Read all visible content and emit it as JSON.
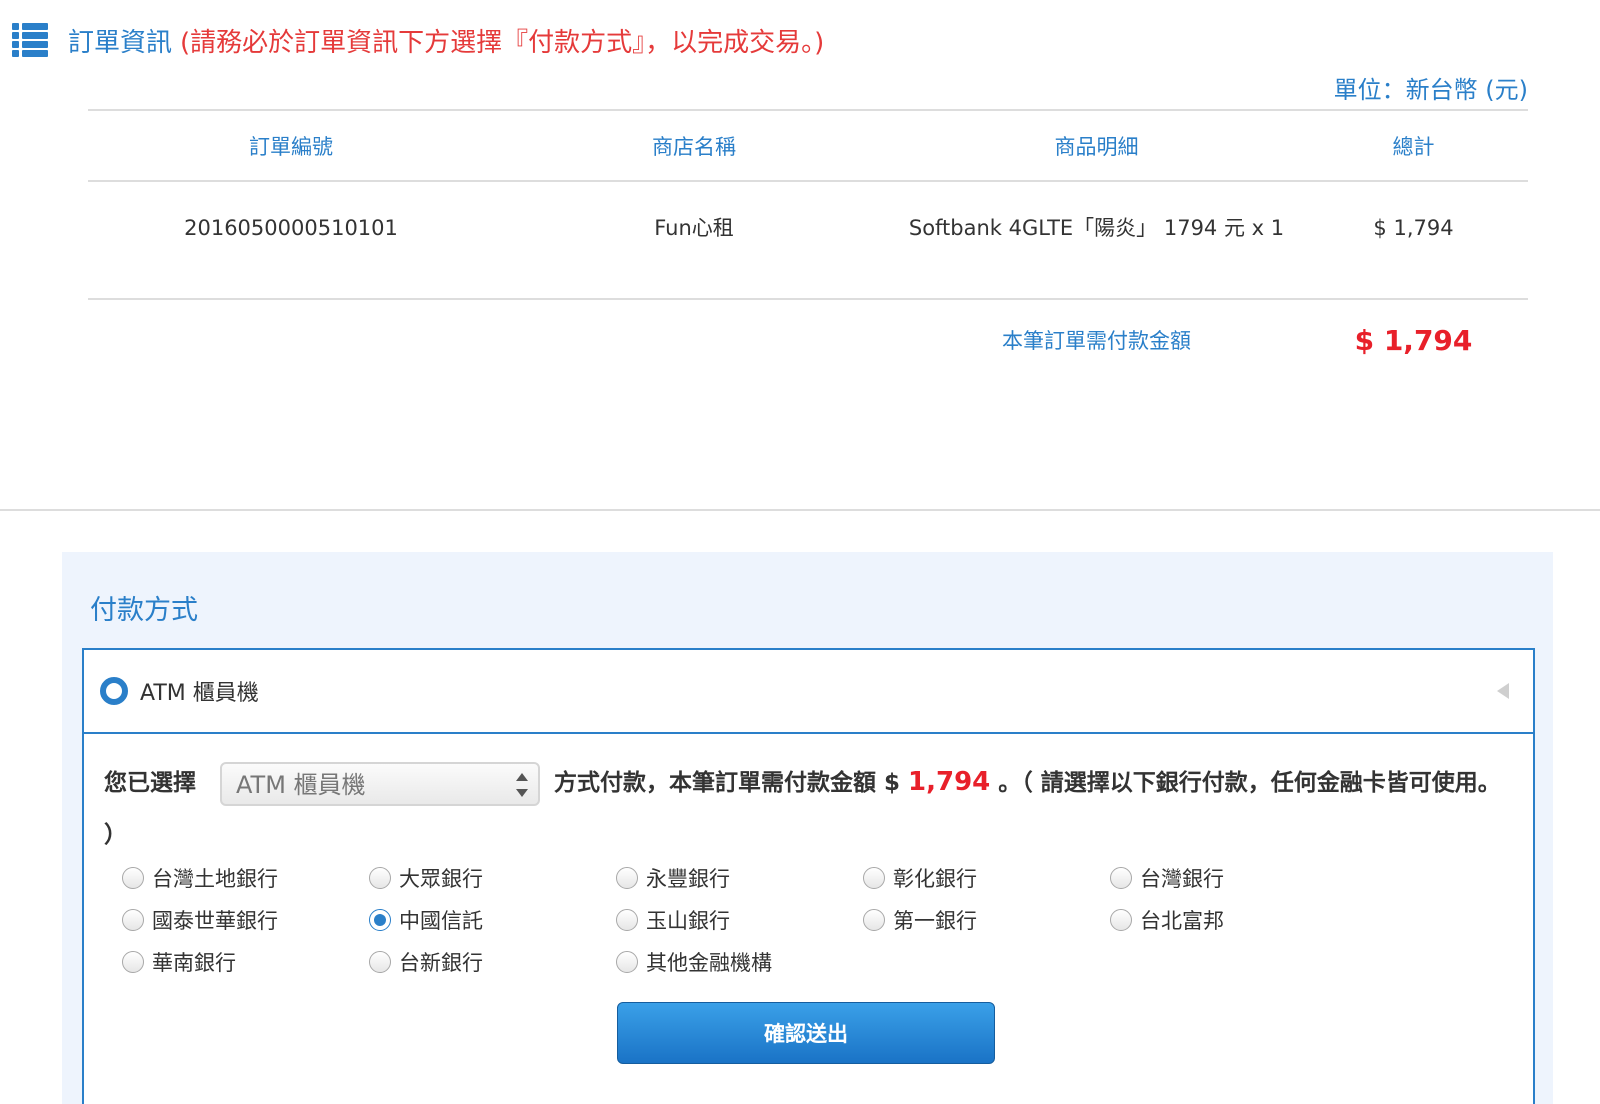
{
  "header": {
    "title": "訂單資訊",
    "note": "(請務必於訂單資訊下方選擇『付款方式』，以完成交易。)",
    "unit": "單位：新台幣 (元)"
  },
  "order_table": {
    "columns": [
      "訂單編號",
      "商店名稱",
      "商品明細",
      "總計"
    ],
    "row": {
      "order_no": "2016050000510101",
      "store": "Fun心租",
      "item": "Softbank 4GLTE「陽炎」 1794 元 x 1",
      "total": "$ 1,794"
    },
    "amount_due_label": "本筆訂單需付款金額",
    "amount_due_value": "$ 1,794"
  },
  "payment": {
    "title": "付款方式",
    "method_label": "ATM 櫃員機",
    "desc_prefix": "您已選擇",
    "select_value": "ATM 櫃員機",
    "desc_mid": "方式付款，本筆訂單需付款金額 $",
    "amount": "1,794",
    "desc_suffix": "。（ 請選擇以下銀行付款，任何金融卡皆可使用。 ）",
    "banks": [
      {
        "name": "台灣土地銀行",
        "checked": false
      },
      {
        "name": "大眾銀行",
        "checked": false
      },
      {
        "name": "永豐銀行",
        "checked": false
      },
      {
        "name": "彰化銀行",
        "checked": false
      },
      {
        "name": "台灣銀行",
        "checked": false
      },
      {
        "name": "國泰世華銀行",
        "checked": false
      },
      {
        "name": "中國信託",
        "checked": true
      },
      {
        "name": "玉山銀行",
        "checked": false
      },
      {
        "name": "第一銀行",
        "checked": false
      },
      {
        "name": "台北富邦",
        "checked": false
      },
      {
        "name": "華南銀行",
        "checked": false
      },
      {
        "name": "台新銀行",
        "checked": false
      },
      {
        "name": "其他金融機構",
        "checked": false
      }
    ],
    "submit_label": "確認送出"
  },
  "colors": {
    "accent": "#2a7fc9",
    "alert": "#e8202a",
    "panel_bg": "#eef4fd"
  }
}
